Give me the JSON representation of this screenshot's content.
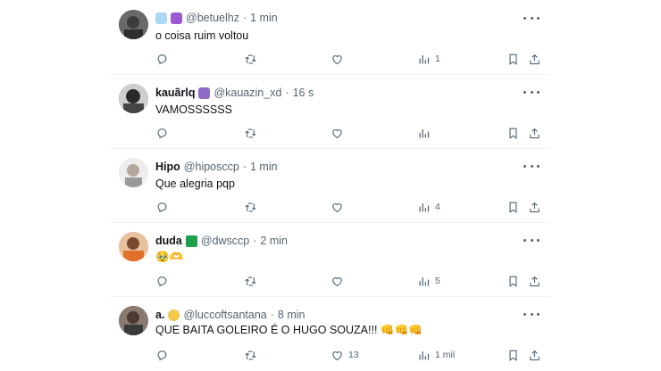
{
  "posts": [
    {
      "display_name": "",
      "badges": [
        "cloud-emoji",
        "purple-symbol-emoji"
      ],
      "handle": "@betuelhz",
      "time": "1 min",
      "text": "o coisa ruim voltou",
      "views": "1",
      "likes": "",
      "avatar_color": "#5a5a5a"
    },
    {
      "display_name": "kauãrlq",
      "badges": [
        "grapes-emoji"
      ],
      "handle": "@kauazin_xd",
      "time": "16 s",
      "text": "VAMOSSSSSS",
      "views": "",
      "likes": "",
      "avatar_color": "#3a3a3a"
    },
    {
      "display_name": "Hipo",
      "badges": [],
      "handle": "@hiposccp",
      "time": "1 min",
      "text": "Que alegria pqp",
      "views": "4",
      "likes": "",
      "avatar_color": "#d8d8d8"
    },
    {
      "display_name": "duda",
      "badges": [
        "brazil-flag-emoji"
      ],
      "handle": "@dwsccp",
      "time": "2 min",
      "text": "🥹🫶",
      "views": "5",
      "likes": "",
      "avatar_color": "#c9855c"
    },
    {
      "display_name": "a.",
      "badges": [
        "crescent-moon-emoji"
      ],
      "handle": "@luccoftsantana",
      "time": "8 min",
      "text": "QUE BAITA GOLEIRO É O HUGO SOUZA!!! 👊👊👊",
      "views": "1 mil",
      "likes": "13",
      "avatar_color": "#6b5a50"
    }
  ],
  "colors": {
    "text": "#0f1419",
    "secondary": "#536471",
    "divider": "#eff3f4"
  }
}
